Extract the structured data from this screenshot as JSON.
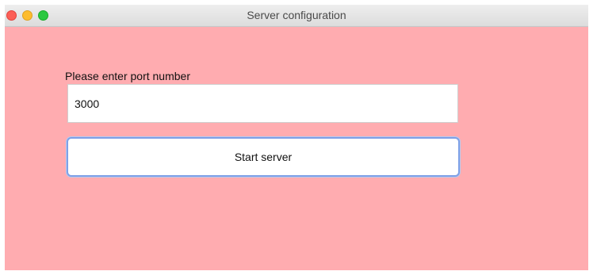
{
  "window": {
    "title": "Server configuration",
    "background_color": "#ffacb0"
  },
  "title_buttons": {
    "close": {
      "icon": "close-dot-icon",
      "color": "#fc5f57"
    },
    "minimize": {
      "icon": "minimize-dot-icon",
      "color": "#fdbc2e"
    },
    "maximize": {
      "icon": "maximize-dot-icon",
      "color": "#2bc840"
    }
  },
  "form": {
    "port_label": "Please enter port number",
    "port_value": "3000",
    "start_button_label": "Start server"
  }
}
